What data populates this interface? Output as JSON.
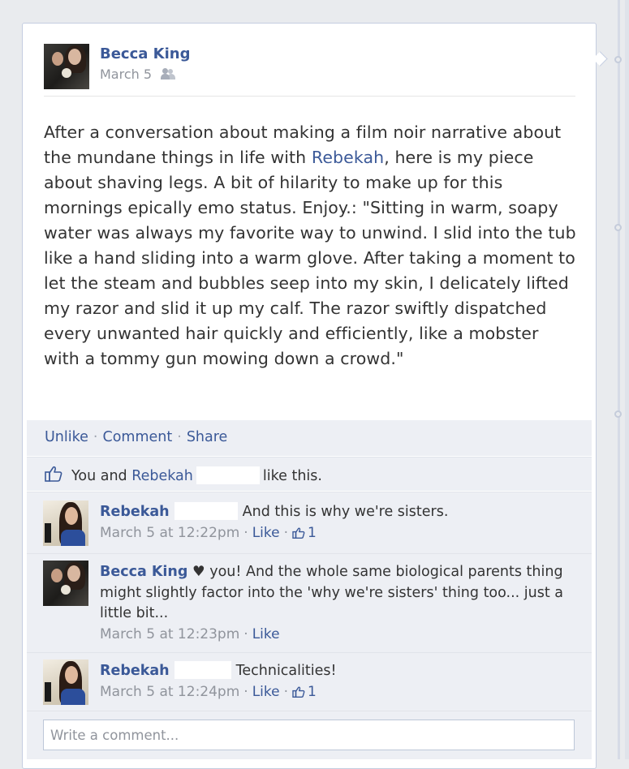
{
  "post": {
    "author": "Becca King",
    "date": "March 5",
    "audience_icon": "friends-icon",
    "body_part1": "After a conversation about making a film noir narrative about the mundane things in life with ",
    "body_mention": "Rebekah",
    "body_part2": ", here is my piece about shaving legs. A bit of hilarity to make up for this mornings epically emo status. Enjoy.: \"Sitting in warm, soapy water was always my favorite way to unwind. I slid into the tub like a hand sliding into a warm glove. After taking a moment to let the steam and bubbles seep into my skin, I delicately lifted my razor and slid it up my calf. The razor swiftly dispatched every unwanted hair quickly and efficiently, like a mobster with a tommy gun mowing down a crowd.\""
  },
  "actions": {
    "unlike": "Unlike",
    "comment": "Comment",
    "share": "Share",
    "separator": "·"
  },
  "likes": {
    "prefix": "You and ",
    "person": "Rebekah",
    "suffix": "like this."
  },
  "comments": [
    {
      "author": "Rebekah",
      "text": "And this is why we're sisters.",
      "time": "March 5 at 12:22pm",
      "like_label": "Like",
      "like_count": "1"
    },
    {
      "author": "Becca King",
      "text": "♥ you! And the whole same biological parents thing might slightly factor into the 'why we're sisters' thing too... just a little bit...",
      "time": "March 5 at 12:23pm",
      "like_label": "Like"
    },
    {
      "author": "Rebekah",
      "text": "Technicalities!",
      "time": "March 5 at 12:24pm",
      "like_label": "Like",
      "like_count": "1"
    }
  ],
  "write_comment": {
    "placeholder": "Write a comment..."
  },
  "colors": {
    "link": "#3b5998",
    "ufi_background": "#edeff4",
    "page_background": "#e9ebee",
    "meta": "#90949c"
  }
}
